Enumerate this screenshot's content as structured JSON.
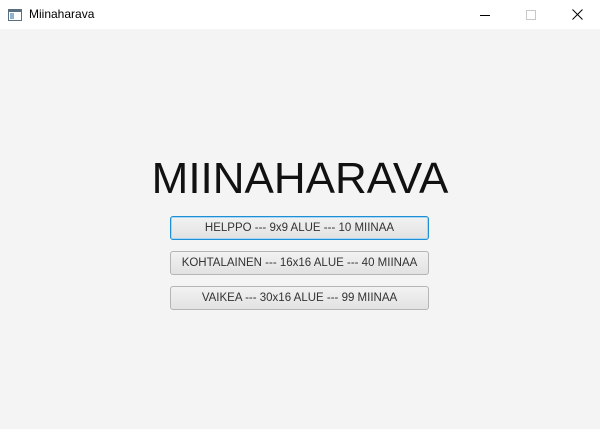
{
  "window": {
    "title": "Miinaharava",
    "app_icon": "window-app-icon",
    "controls": {
      "minimize_icon": "minimize-icon",
      "maximize_icon": "maximize-icon",
      "close_icon": "close-icon"
    }
  },
  "main": {
    "heading": "MIINAHARAVA",
    "buttons": [
      {
        "label": "HELPPO --- 9x9 ALUE --- 10 MIINAA",
        "focused": true
      },
      {
        "label": "KOHTALAINEN --- 16x16 ALUE --- 40 MIINAA",
        "focused": false
      },
      {
        "label": "VAIKEA --- 30x16 ALUE --- 99 MIINAA",
        "focused": false
      }
    ]
  },
  "colors": {
    "background": "#f4f4f4",
    "titlebar": "#ffffff",
    "focus_border": "#1e8fd2"
  }
}
